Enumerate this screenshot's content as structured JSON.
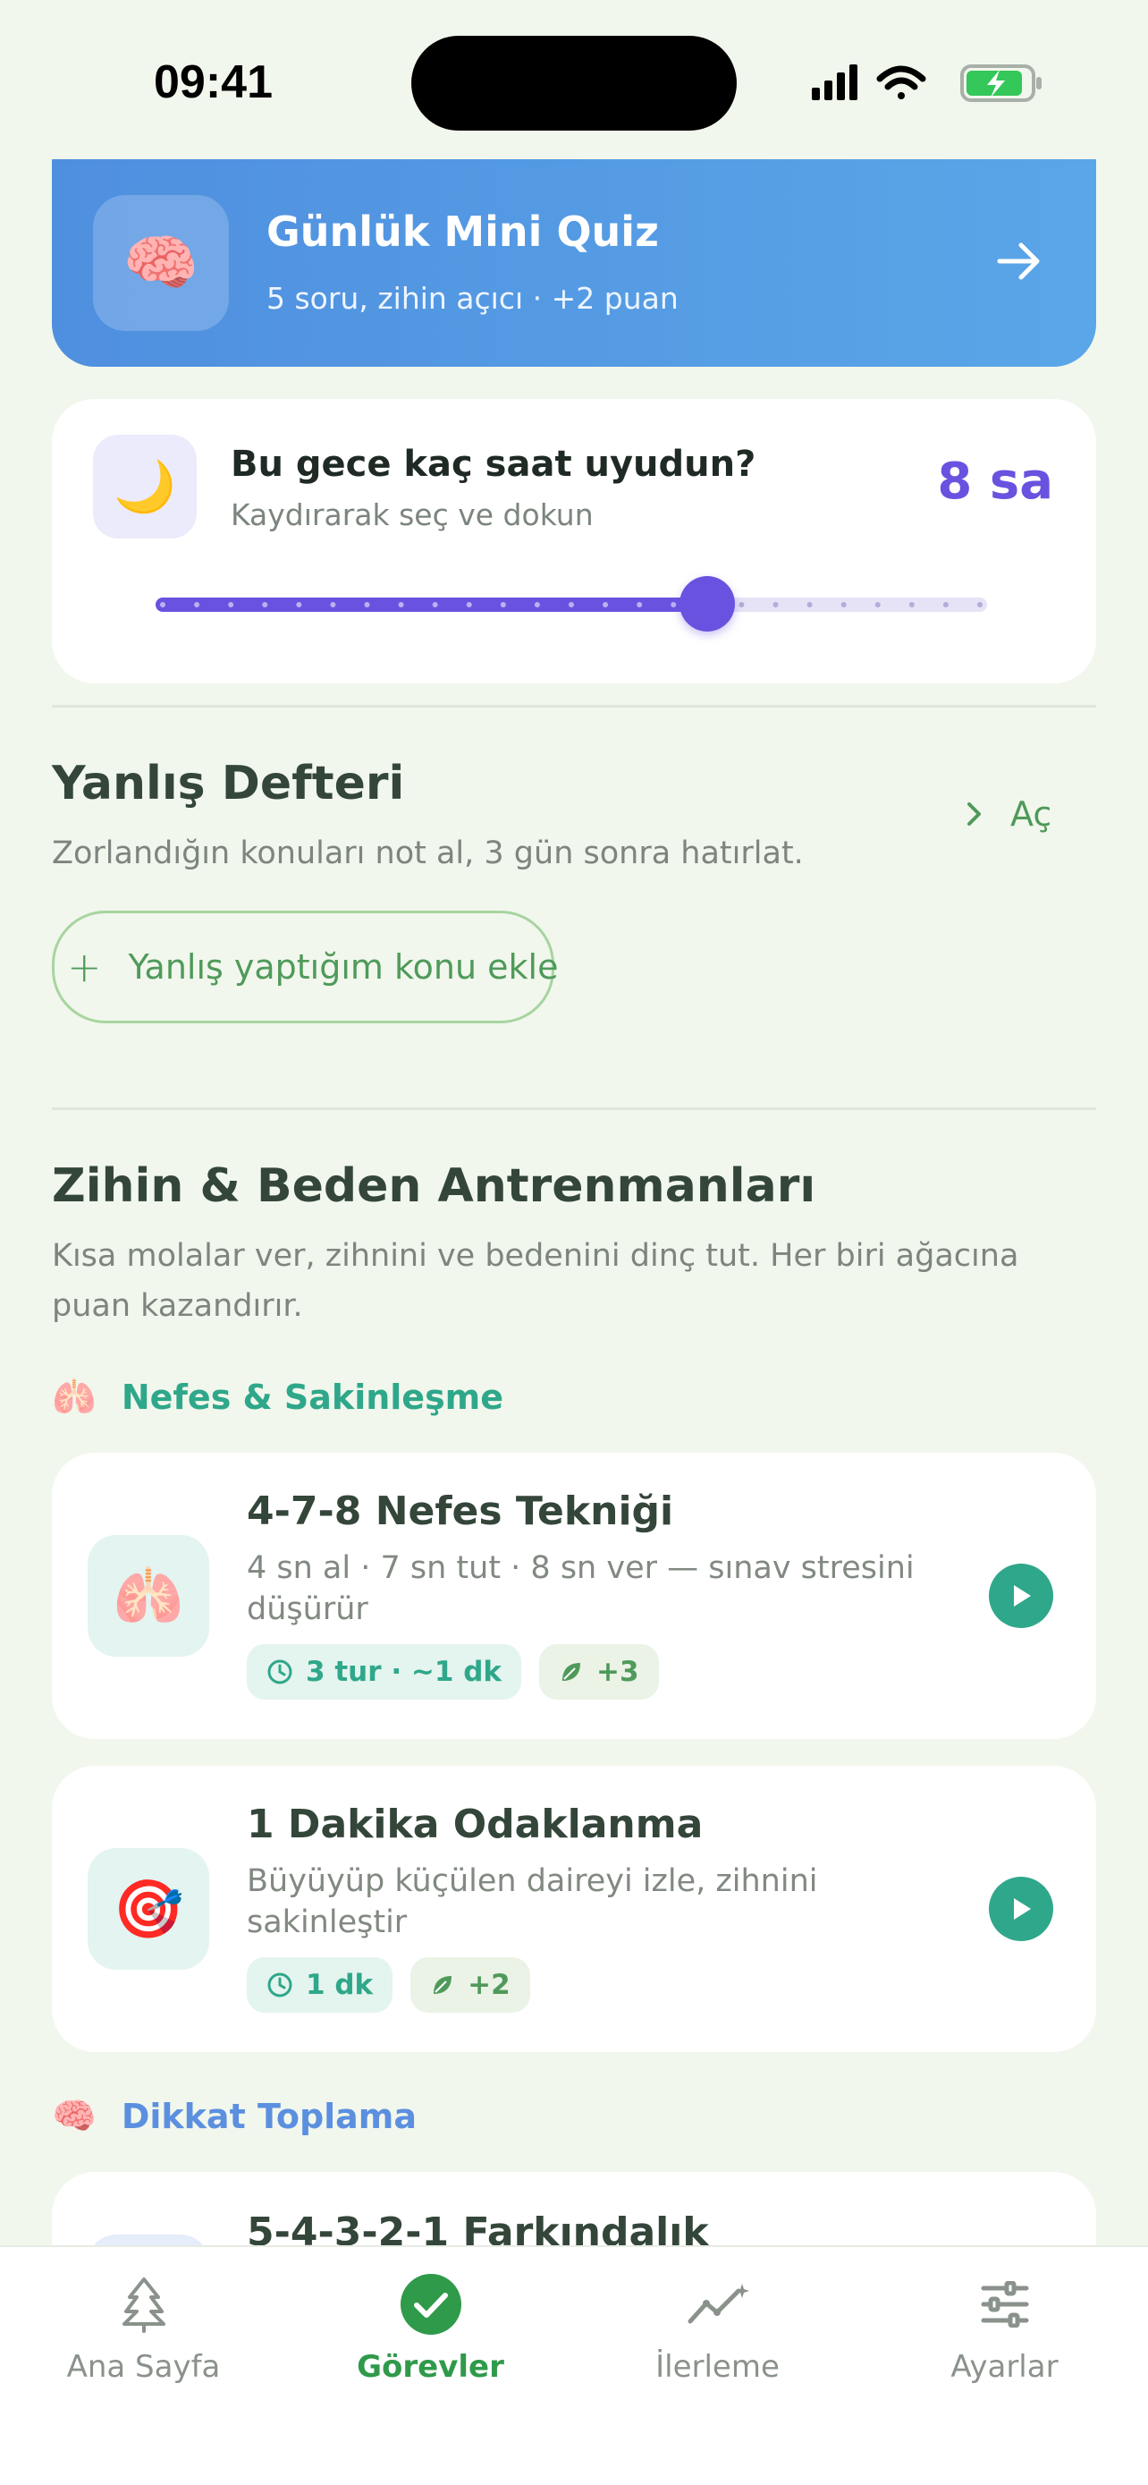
{
  "status_bar": {
    "time": "09:41"
  },
  "quiz": {
    "title": "Günlük Mini Quiz",
    "subtitle": "5 soru, zihin açıcı · +2 puan",
    "icon": "brain-icon"
  },
  "sleep": {
    "question": "Bu gece kaç saat uyudun?",
    "hint": "Kaydırarak seç ve dokun",
    "value_label": "8 sa",
    "icon": "crescent-moon-icon",
    "slider_value": 8,
    "slider_max": 12,
    "accent": "#6a52e0"
  },
  "mistakes": {
    "title": "Yanlış Defteri",
    "subtitle": "Zorlandığın konuları not al, 3 gün sonra hatırlat.",
    "open_label": "Aç",
    "add_label": "Yanlış yaptığım konu ekle"
  },
  "training": {
    "title": "Zihin & Beden Antrenmanları",
    "subtitle": "Kısa molalar ver, zihnini ve bedenini dinç tut. Her biri ağacına puan kazandırır.",
    "categories": [
      {
        "label": "Nefes & Sakinleşme",
        "color": "#2fa78a",
        "icon": "lungs-icon"
      },
      {
        "label": "Dikkat Toplama",
        "color": "#5b8fe0",
        "icon": "brain-icon"
      }
    ],
    "exercises": [
      {
        "title": "4-7-8 Nefes Tekniği",
        "description": "4 sn al · 7 sn tut · 8 sn ver — sınav stresini düşürür",
        "duration": "3 tur · ~1 dk",
        "points": "+3",
        "icon": "lungs-icon"
      },
      {
        "title": "1 Dakika Odaklanma",
        "description": "Büyüyüp küçülen daireyi izle, zihnini sakinleştir",
        "duration": "1 dk",
        "points": "+2",
        "icon": "target-icon"
      },
      {
        "title": "5-4-3-2-1 Farkındalık"
      }
    ]
  },
  "tabs": [
    {
      "label": "Ana Sayfa",
      "icon": "tree-icon",
      "active": false
    },
    {
      "label": "Görevler",
      "icon": "check-circle-icon",
      "active": true
    },
    {
      "label": "İlerleme",
      "icon": "chart-sparkle-icon",
      "active": false
    },
    {
      "label": "Ayarlar",
      "icon": "sliders-icon",
      "active": false
    }
  ]
}
